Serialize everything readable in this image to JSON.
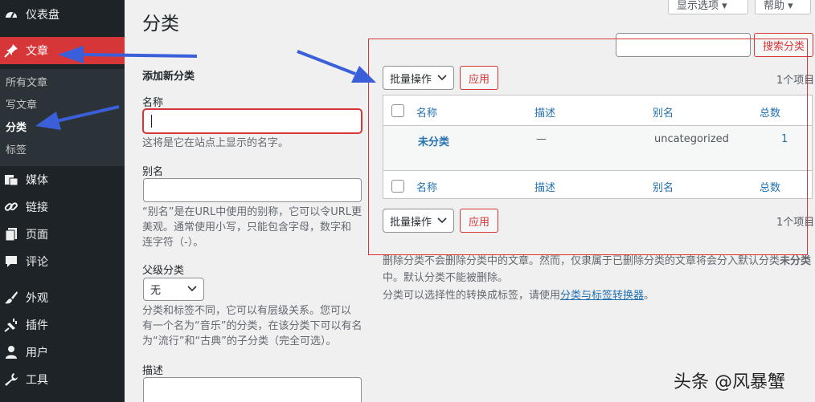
{
  "sidebar": {
    "items": [
      {
        "label": "仪表盘",
        "icon": "dashboard-icon"
      },
      {
        "label": "文章",
        "icon": "pin-icon"
      },
      {
        "label": "媒体",
        "icon": "media-icon"
      },
      {
        "label": "链接",
        "icon": "link-icon"
      },
      {
        "label": "页面",
        "icon": "page-icon"
      },
      {
        "label": "评论",
        "icon": "comment-icon"
      },
      {
        "label": "外观",
        "icon": "brush-icon"
      },
      {
        "label": "插件",
        "icon": "plugin-icon"
      },
      {
        "label": "用户",
        "icon": "user-icon"
      },
      {
        "label": "工具",
        "icon": "wrench-icon"
      }
    ],
    "submenu": [
      "所有文章",
      "写文章",
      "分类",
      "标签"
    ]
  },
  "header": {
    "title": "分类",
    "screen_options": "显示选项 ▾",
    "help": "帮助 ▾"
  },
  "form": {
    "heading": "添加新分类",
    "name_label": "名称",
    "name_hint": "这将是它在站点上显示的名字。",
    "slug_label": "别名",
    "slug_hint": [
      "“别名”是在URL中使用的别称，它可以令URL更",
      "美观。通常使用小写，只能包含字母，数字和",
      "连字符（-）。"
    ],
    "parent_label": "父级分类",
    "parent_value": "无",
    "parent_hint": [
      "分类和标签不同，它可以有层级关系。您可以",
      "有一个名为“音乐”的分类，在该分类下可以有名",
      "为“流行”和“古典”的子分类（完全可选）。"
    ],
    "desc_label": "描述"
  },
  "list": {
    "search_button": "搜索分类",
    "bulk_label": "批量操作",
    "apply": "应用",
    "count": "1个项目",
    "columns": [
      "名称",
      "描述",
      "别名",
      "总数"
    ],
    "rows": [
      {
        "name": "未分类",
        "desc": "—",
        "slug": "uncategorized",
        "count": "1"
      }
    ],
    "note1a": "删除分类不会删除分类中的文章。然而，仅隶属于已删除分类的文章将会分入默认分类",
    "note1b": "未分类",
    "note1c": "中。默认分类不能被删除。",
    "note2a": "分类可以选择性的转换成标签，请使用",
    "note2link": "分类与标签转换器",
    "note2b": "。"
  },
  "watermark": "头条 @风暴蟹",
  "colors": {
    "accent": "#d63638",
    "arrow": "#3a5fd9",
    "sidebar": "#1d2327",
    "link": "#2271b1"
  }
}
